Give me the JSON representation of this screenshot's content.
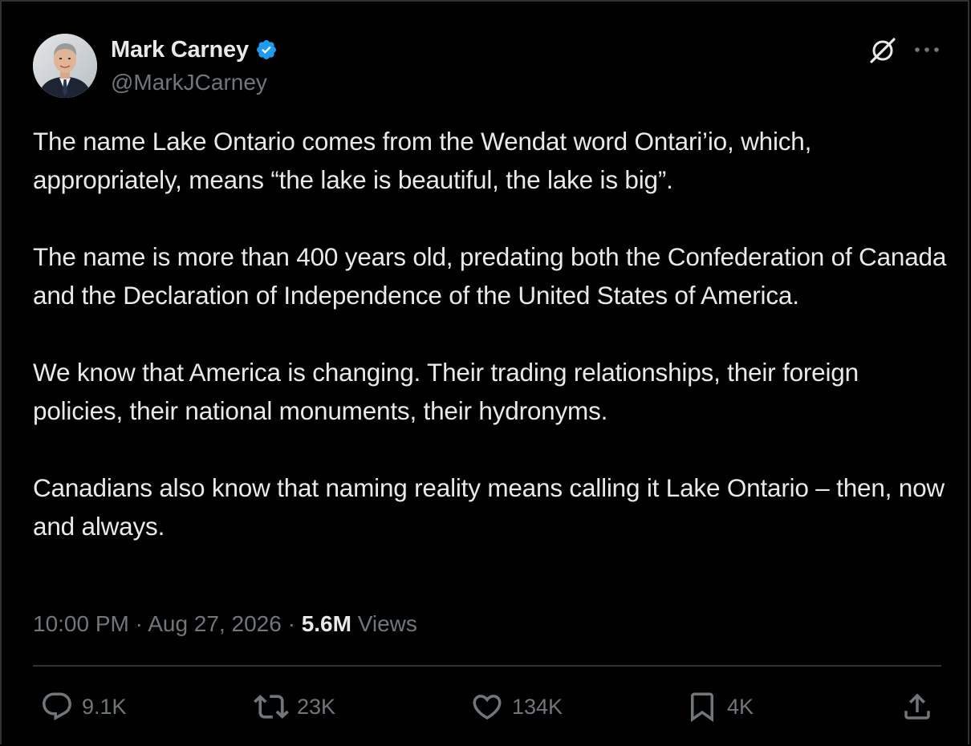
{
  "author": {
    "display_name": "Mark Carney",
    "handle": "@MarkJCarney",
    "verified_icon": "verified-badge-icon",
    "verified_color": "#1d9bf0"
  },
  "header_icons": [
    "grok-icon",
    "more-icon"
  ],
  "tweet": {
    "text": "The name Lake Ontario comes from the Wendat word Ontari’io, which, appropriately, means “the lake is beautiful, the lake is big”.\n\nThe name is more than 400 years old, predating both the Confederation of Canada and the Declaration of Independence of the United States of America.\n\nWe know that America is changing. Their trading relationships, their foreign policies, their national monuments, their hydronyms.\n\nCanadians also know that naming reality means calling it Lake Ontario – then, now and always."
  },
  "meta": {
    "time": "10:00 PM",
    "separator": "·",
    "date": "Aug 27, 2026",
    "views_count": "5.6M",
    "views_label": "Views"
  },
  "actions": {
    "reply": {
      "icon": "reply-icon",
      "count": "9.1K"
    },
    "repost": {
      "icon": "repost-icon",
      "count": "23K"
    },
    "like": {
      "icon": "heart-icon",
      "count": "134K"
    },
    "bookmark": {
      "icon": "bookmark-icon",
      "count": "4K"
    },
    "share": {
      "icon": "share-icon"
    }
  },
  "colors": {
    "background": "#000000",
    "text_primary": "#e7e9ea",
    "text_secondary": "#71767b",
    "divider": "#2f3336"
  }
}
